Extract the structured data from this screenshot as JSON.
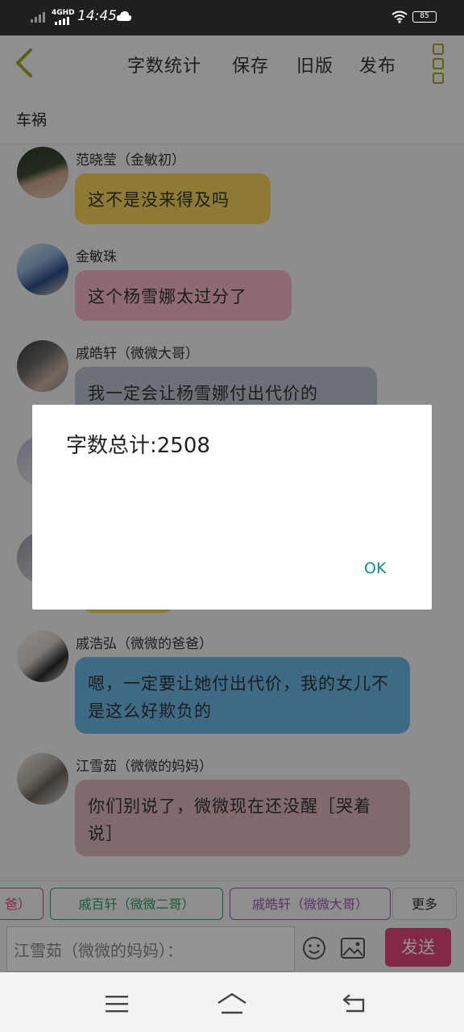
{
  "status_bar": {
    "network": "4GHD",
    "time": "14:45",
    "battery": "85"
  },
  "topbar": {
    "actions": [
      "字数统计",
      "保存",
      "旧版",
      "发布"
    ]
  },
  "title": "车祸",
  "messages": [
    {
      "sender": "范晓莹（金敏初）",
      "text": "这不是没来得及吗",
      "color": "#f3d35a"
    },
    {
      "sender": "金敏珠",
      "text": "这个杨雪娜太过分了",
      "color": "#f4b7c4"
    },
    {
      "sender": "戚皓轩（微微大哥）",
      "text": "我一定会让杨雪娜付出代价的",
      "color": "#b8c3cc"
    },
    {
      "sender": "戚浩弘（微微的爸爸）",
      "text": "嗯，一定要让她付出代价，我的女儿不是这么好欺负的",
      "color": "#6cb7e6"
    },
    {
      "sender": "江雪茹（微微的妈妈）",
      "text": "你们别说了，微微现在还没醒［哭着说］",
      "color": "#dcb7bd"
    }
  ],
  "chips": {
    "partial": "爸）",
    "second_brother": "戚百轩（微微二哥）",
    "big_brother": "戚皓轩（微微大哥）",
    "more": "更多"
  },
  "input": {
    "value": "江雪茹（微微的妈妈）："
  },
  "send_label": "发送",
  "dialog": {
    "message": "字数总计:2508",
    "ok_label": "OK"
  },
  "icons": {
    "back": "chevron-left-icon",
    "menu": "more-vertical-icon",
    "emoji": "emoji-icon",
    "image": "image-icon",
    "nav_menu": "menu-icon",
    "nav_home": "home-icon",
    "nav_back": "back-icon"
  },
  "accent": "#a9a21a"
}
